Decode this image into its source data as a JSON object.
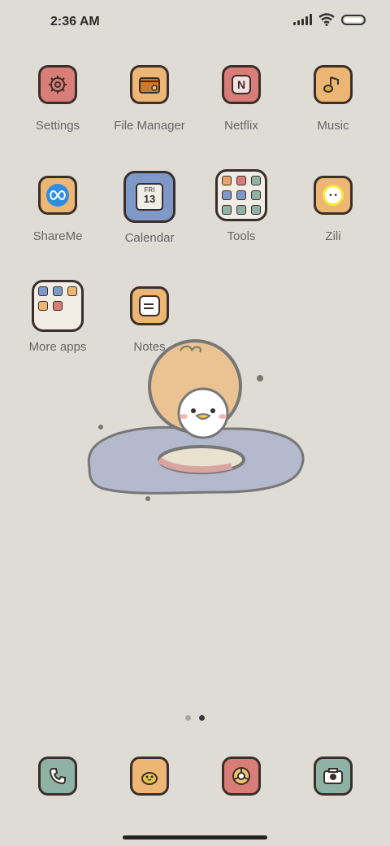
{
  "status": {
    "time": "2:36 AM"
  },
  "apps": [
    {
      "label": "Settings",
      "icon": "gear-icon",
      "color": "#d97d79"
    },
    {
      "label": "File Manager",
      "icon": "folder-icon",
      "color": "#eeb675"
    },
    {
      "label": "Netflix",
      "icon": "netflix-icon",
      "color": "#d97d79"
    },
    {
      "label": "Music",
      "icon": "music-note-icon",
      "color": "#eeb675"
    },
    {
      "label": "ShareMe",
      "icon": "infinity-icon",
      "color": "#eeb675"
    },
    {
      "label": "Calendar",
      "icon": "calendar-icon",
      "color": "#7e98c8",
      "calendar_day": "FRI",
      "calendar_date": "13"
    },
    {
      "label": "Tools",
      "icon": "folder-tools-icon",
      "color": "#f1ede4"
    },
    {
      "label": "Zili",
      "icon": "zili-icon",
      "color": "#eeb675"
    },
    {
      "label": "More apps",
      "icon": "folder-more-apps-icon",
      "color": "#f1ede4"
    },
    {
      "label": "Notes",
      "icon": "notes-icon",
      "color": "#eeb675"
    }
  ],
  "dock": [
    {
      "icon": "phone-icon",
      "color": "#8fb2a6"
    },
    {
      "icon": "duck-icon",
      "color": "#eeb675"
    },
    {
      "icon": "browser-icon",
      "color": "#d97d79"
    },
    {
      "icon": "camera-icon",
      "color": "#8fb2a6"
    }
  ]
}
